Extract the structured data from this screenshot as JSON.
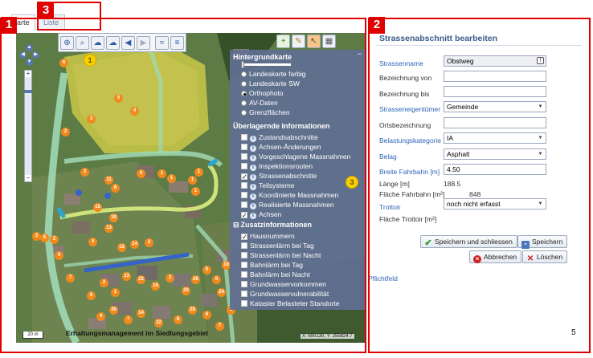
{
  "tabs": [
    {
      "label": "arte",
      "active": true
    },
    {
      "label": "Liste",
      "active": false
    }
  ],
  "markers": {
    "red": [
      "1",
      "2",
      "3"
    ],
    "yellow": [
      "1",
      "2",
      "3"
    ]
  },
  "map": {
    "scale": "20 m",
    "caption": "Erhaltungsmanagement im Siedlungsgebiet",
    "coordinates": "X: 690130, Y: 255824.7",
    "parcel_numbers": [
      "6",
      "3",
      "5",
      "4",
      "2",
      "9",
      "1",
      "1",
      "1",
      "1",
      "1",
      "3",
      "5",
      "2",
      "9",
      "3",
      "11",
      "8",
      "15",
      "10",
      "13",
      "4",
      "12",
      "14",
      "2",
      "7",
      "6",
      "2",
      "1",
      "13",
      "22",
      "16",
      "3",
      "20",
      "26",
      "5",
      "9",
      "10",
      "24",
      "4",
      "30",
      "7",
      "14",
      "32",
      "8",
      "28",
      "6",
      "7",
      "2"
    ],
    "side_number": "5"
  },
  "layer_panel": {
    "background_title": "Hintergrundkarte",
    "background_options": [
      {
        "label": "Landeskarte farbig",
        "selected": false
      },
      {
        "label": "Landeskarte SW",
        "selected": false
      },
      {
        "label": "Orthophoto",
        "selected": true
      },
      {
        "label": "AV-Daten",
        "selected": false
      },
      {
        "label": "Grenzflächen",
        "selected": false
      }
    ],
    "overlay_title": "Überlagernde Informationen",
    "overlays": [
      {
        "label": "Zustandsabschnitte",
        "checked": false
      },
      {
        "label": "Achsen-Änderungen",
        "checked": false
      },
      {
        "label": "Vorgeschlagene Massnahmen",
        "checked": false
      },
      {
        "label": "Inspektionsrouten",
        "checked": false
      },
      {
        "label": "Strassenabschnitte",
        "checked": true
      },
      {
        "label": "Teilsysteme",
        "checked": false
      },
      {
        "label": "Koordinierte Massnahmen",
        "checked": false
      },
      {
        "label": "Realisierte Massnahmen",
        "checked": false
      },
      {
        "label": "Achsen",
        "checked": true
      }
    ],
    "extra_title": "Zusatzinformationen",
    "extras": [
      {
        "label": "Hausnummern",
        "checked": true
      },
      {
        "label": "Strassenlärm bei Tag",
        "checked": false
      },
      {
        "label": "Strassenlärm bei Nacht",
        "checked": false
      },
      {
        "label": "Bahnlärm bei Tag",
        "checked": false
      },
      {
        "label": "Bahnlärm bei Nacht",
        "checked": false
      },
      {
        "label": "Grundwasservorkommen",
        "checked": false
      },
      {
        "label": "Grundwasservulnerabilität",
        "checked": false
      },
      {
        "label": "Kataster Belasteter Standorte",
        "checked": false
      }
    ]
  },
  "form": {
    "title": "Strassenabschnitt bearbeiten",
    "labels": {
      "strassenname": "Strassenname",
      "bez_von": "Bezeichnung von",
      "bez_bis": "Bezeichnung bis",
      "eigentuemer": "Strasseneigentümer",
      "ortsbez": "Ortsbezeichnung",
      "belastung": "Belastungskategorie",
      "belag": "Belag",
      "breite": "Breite Fahrbahn [m]",
      "laenge": "Länge [m]",
      "flaeche_fb": "Fläche Fahrbahn [m²]",
      "trottoir": "Trottoir",
      "flaeche_tr": "Fläche Trottoir [m²]"
    },
    "values": {
      "strassenname": "Obstweg",
      "bez_von": "",
      "bez_bis": "",
      "eigentuemer": "Gemeinde",
      "ortsbez": "",
      "belastung": "IA",
      "belag": "Asphalt",
      "breite": "4.50",
      "laenge": "188.5",
      "flaeche_fb": "848",
      "trottoir": "noch nicht erfasst"
    },
    "buttons": {
      "save_close": "Speichern und schliessen",
      "save": "Speichern",
      "cancel": "Abbrechen",
      "delete": "Löschen"
    },
    "footer": "Pflichtfeld"
  },
  "colors": {
    "accent": "#e00000",
    "link": "#2f64b6",
    "panel": "#606f92",
    "badge": "#f5d100"
  }
}
